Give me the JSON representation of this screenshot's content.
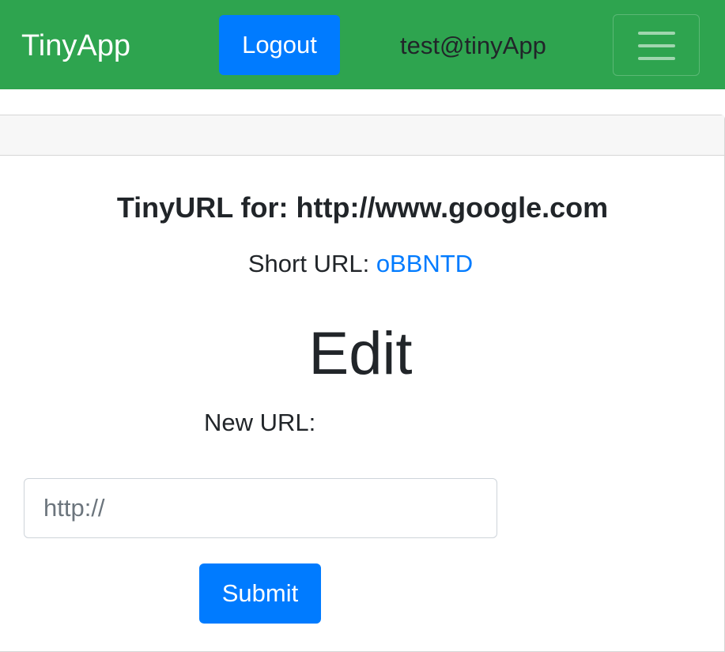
{
  "navbar": {
    "brand": "TinyApp",
    "logout_label": "Logout",
    "user_email": "test@tinyApp",
    "toggler_icon": "hamburger-menu-icon"
  },
  "main": {
    "title_prefix": "TinyURL for: ",
    "long_url": "http://www.google.com",
    "short_url_label": "Short URL: ",
    "short_url": "oBBNTD",
    "edit_heading": "Edit",
    "new_url_label": "New URL:",
    "new_url_placeholder": "http://",
    "new_url_value": "",
    "submit_label": "Submit"
  },
  "colors": {
    "navbar_bg": "#2ea44f",
    "primary": "#007bff",
    "text": "#212529"
  }
}
